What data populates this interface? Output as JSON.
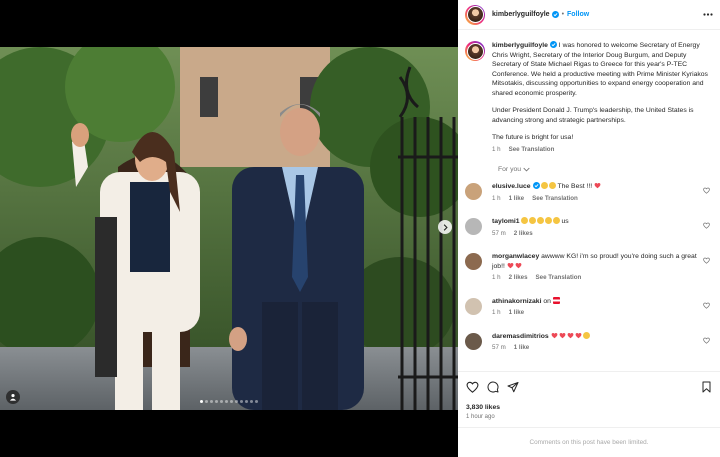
{
  "post": {
    "username": "kimberlyguilfoyle",
    "follow_label": "Follow",
    "separator": "•",
    "caption_paragraphs": [
      "I was honored to welcome Secretary of Energy Chris Wright, Secretary of the Interior Doug Burgum, and Deputy Secretary of State Michael Rigas to Greece for this year's P-TEC Conference. We held a productive meeting with Prime Minister Kyriakos Mitsotakis, discussing opportunities to expand energy cooperation and shared economic prosperity.",
      "Under President Donald J. Trump's leadership, the United States is advancing strong and strategic partnerships.",
      "The future is bright for usa!"
    ],
    "caption_time": "1 h",
    "see_translation": "See Translation",
    "for_you_label": "For you",
    "likes": "3,830 likes",
    "posted_ago": "1 hour ago",
    "comments_limited": "Comments on this post have been limited."
  },
  "comments": [
    {
      "user": "elusive.luce",
      "verified": true,
      "text": "The Best !!!",
      "emoji_before": [
        "clap",
        "clap"
      ],
      "emoji_after": [
        "heart"
      ],
      "time": "1 h",
      "likes": "1 like",
      "translate": "See Translation"
    },
    {
      "user": "taylomi1",
      "verified": false,
      "text": "us",
      "emoji_before": [
        "clap",
        "clap",
        "clap",
        "clap",
        "clap"
      ],
      "emoji_after": [],
      "time": "57 m",
      "likes": "2 likes",
      "translate": ""
    },
    {
      "user": "morganwlacey",
      "verified": false,
      "text": "awwww KG! i'm so proud! you're doing such a great job!!",
      "emoji_before": [],
      "emoji_after": [
        "heart",
        "heart"
      ],
      "time": "1 h",
      "likes": "2 likes",
      "translate": "See Translation"
    },
    {
      "user": "athinakornizaki",
      "verified": false,
      "text": "on",
      "emoji_before": [],
      "emoji_after": [
        "flag"
      ],
      "time": "1 h",
      "likes": "1 like",
      "translate": ""
    },
    {
      "user": "daremasdimitrios",
      "verified": false,
      "text": "",
      "emoji_before": [],
      "emoji_after": [
        "heart",
        "heart",
        "heart",
        "heart",
        "clap"
      ],
      "time": "57 m",
      "likes": "1 like",
      "translate": ""
    }
  ],
  "media": {
    "slide_count": 12,
    "active_slide": 1
  },
  "colors": {
    "accent": "#0095f6",
    "heart": "#ed4956",
    "muted": "#737373"
  }
}
